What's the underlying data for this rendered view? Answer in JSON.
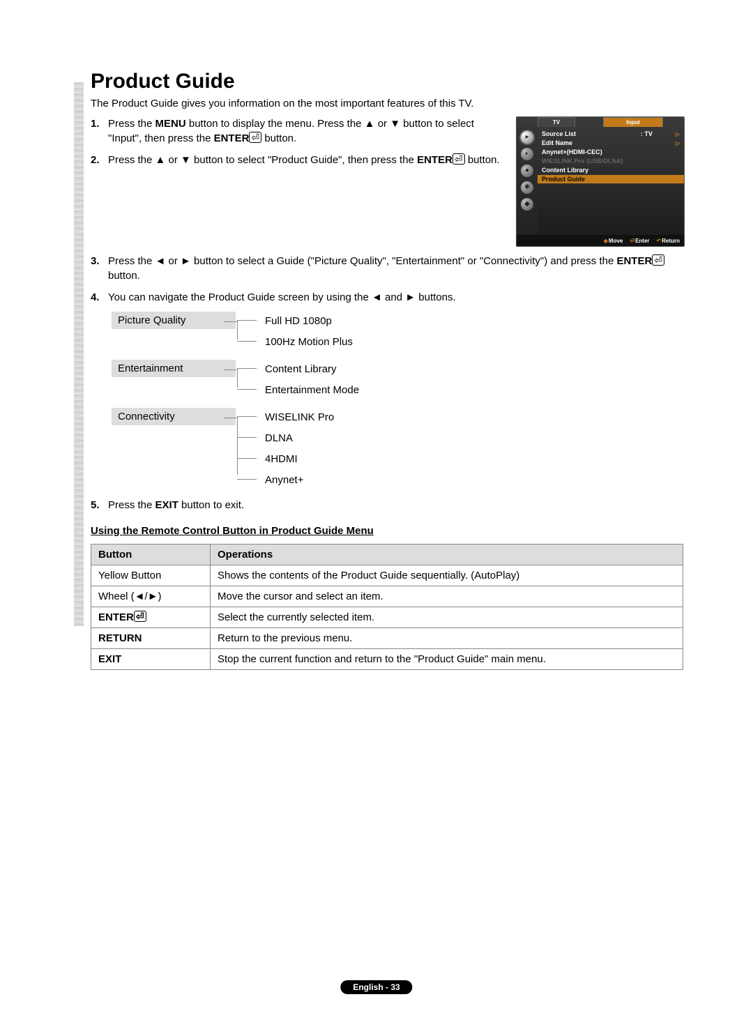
{
  "title": "Product Guide",
  "intro": "The Product Guide gives you information on the most important features of this TV.",
  "steps": {
    "s1_a": "Press the ",
    "s1_menu": "MENU",
    "s1_b": " button to display the menu. Press the ▲ or ▼ button to select \"Input\", then press the ",
    "s1_enter": "ENTER",
    "s1_c": " button.",
    "s2_a": "Press the ▲ or ▼ button to select \"Product Guide\", then press the ",
    "s2_enter": "ENTER",
    "s2_b": " button.",
    "s3_a": "Press the ◄ or ► button to select a Guide (\"Picture Quality\", \"Entertainment\" or \"Connectivity\") and press the ",
    "s3_enter": "ENTER",
    "s3_b": " button.",
    "s4": "You can navigate the Product Guide screen by using the ◄ and ► buttons.",
    "s5_a": "Press the ",
    "s5_exit": "EXIT",
    "s5_b": " button to exit."
  },
  "osd": {
    "tab_tv": "TV",
    "tab_input": "Input",
    "rows": [
      {
        "label": "Source List",
        "value": ": TV",
        "arrow": true
      },
      {
        "label": "Edit Name",
        "value": "",
        "arrow": true
      },
      {
        "label": "Anynet+(HDMI-CEC)",
        "value": "",
        "arrow": false
      },
      {
        "label": "WIESLINK Pro (USB/DLNA)",
        "value": "",
        "arrow": false,
        "dim": true
      },
      {
        "label": "Content Library",
        "value": "",
        "arrow": false
      },
      {
        "label": "Product Guide",
        "value": "",
        "highlight": true
      }
    ],
    "footer": {
      "move": "Move",
      "enter": "Enter",
      "return": "Return"
    }
  },
  "tree": [
    {
      "cat": "Picture Quality",
      "items": [
        "Full HD 1080p",
        "100Hz Motion Plus"
      ]
    },
    {
      "cat": "Entertainment",
      "items": [
        "Content Library",
        "Entertainment Mode"
      ]
    },
    {
      "cat": "Connectivity",
      "items": [
        "WISELINK Pro",
        "DLNA",
        "4HDMI",
        "Anynet+"
      ]
    }
  ],
  "subhead": "Using the Remote Control Button in Product Guide Menu",
  "table": {
    "headers": [
      "Button",
      "Operations"
    ],
    "rows": [
      {
        "btn": "Yellow Button",
        "op": "Shows the contents of the Product Guide sequentially. (AutoPlay)",
        "bold": false
      },
      {
        "btn": "Wheel (◄/►)",
        "op": "Move the cursor and select an item.",
        "bold": false
      },
      {
        "btn": "ENTER",
        "op": "Select the currently selected item.",
        "bold": true,
        "enter": true
      },
      {
        "btn": "RETURN",
        "op": "Return to the previous menu.",
        "bold": true
      },
      {
        "btn": "EXIT",
        "op": "Stop the current function and return to the \"Product Guide\" main menu.",
        "bold": true
      }
    ]
  },
  "page_footer": "English - 33",
  "enter_glyph": "⏎"
}
